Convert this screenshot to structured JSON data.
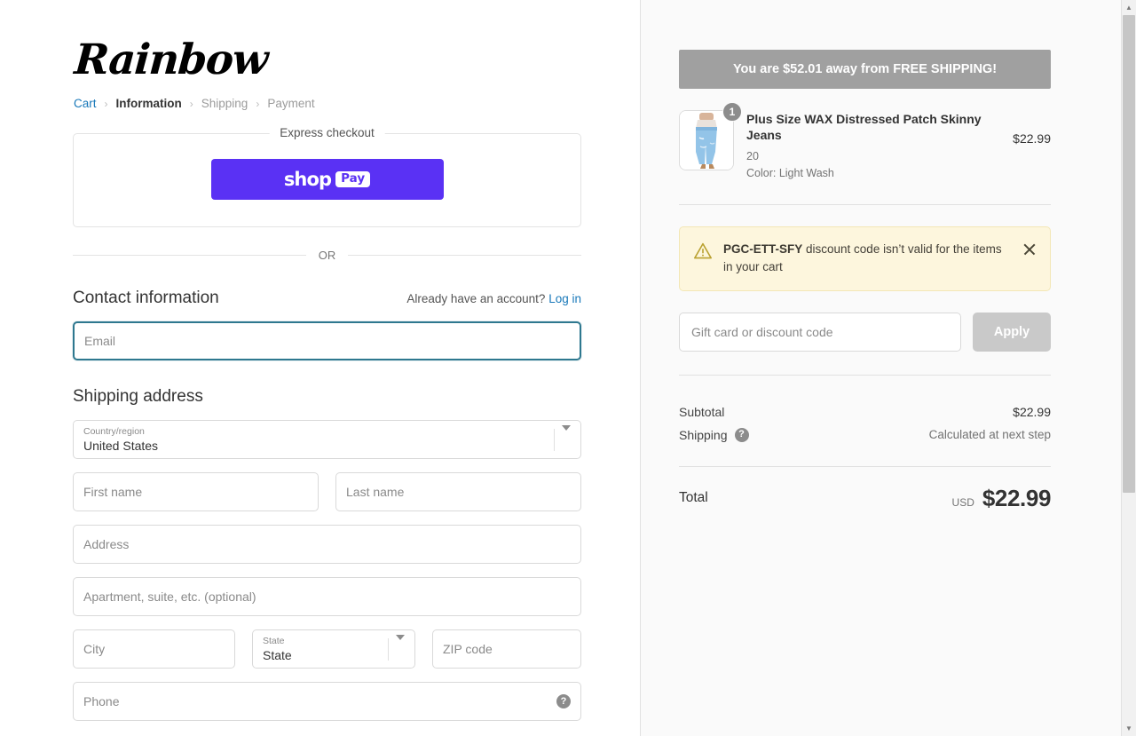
{
  "brand": {
    "logo_text": "Rainbow"
  },
  "breadcrumb": [
    {
      "label": "Cart",
      "state": "link"
    },
    {
      "label": "Information",
      "state": "current"
    },
    {
      "label": "Shipping",
      "state": "future"
    },
    {
      "label": "Payment",
      "state": "future"
    }
  ],
  "breadcrumb_separator": "›",
  "express": {
    "legend": "Express checkout",
    "shop_pay_word": "shop",
    "shop_pay_badge": "Pay"
  },
  "divider_text": "OR",
  "contact": {
    "title": "Contact information",
    "account_prompt": "Already have an account?",
    "login_label": "Log in",
    "email_placeholder": "Email",
    "email_value": ""
  },
  "shipping_address": {
    "title": "Shipping address",
    "country_label": "Country/region",
    "country_value": "United States",
    "first_name_placeholder": "First name",
    "last_name_placeholder": "Last name",
    "address_placeholder": "Address",
    "apartment_placeholder": "Apartment, suite, etc. (optional)",
    "city_placeholder": "City",
    "state_label": "State",
    "state_value": "State",
    "zip_placeholder": "ZIP code",
    "phone_placeholder": "Phone",
    "phone_help_icon": "question-mark"
  },
  "summary": {
    "free_shipping_banner": "You are $52.01 away from FREE SHIPPING!",
    "line_item": {
      "quantity": "1",
      "title": "Plus Size WAX Distressed Patch Skinny Jeans",
      "size": "20",
      "color": "Color: Light Wash",
      "price": "$22.99",
      "image_alt": "light wash skinny jeans"
    },
    "alert": {
      "icon": "warning-triangle-icon",
      "code": "PGC-ETT-SFY",
      "message": " discount code isn’t valid for the items in your cart",
      "close_icon": "close-icon"
    },
    "discount": {
      "placeholder": "Gift card or discount code",
      "value": "",
      "apply_label": "Apply"
    },
    "totals": {
      "subtotal_label": "Subtotal",
      "subtotal_value": "$22.99",
      "shipping_label": "Shipping",
      "shipping_help_icon": "question-mark",
      "shipping_value": "Calculated at next step",
      "total_label": "Total",
      "currency": "USD",
      "total_value": "$22.99"
    }
  },
  "colors": {
    "accent_focus": "#2e788f",
    "link": "#1878b9",
    "shop_pay_purple": "#5a31f4",
    "banner_gray": "#a0a0a0",
    "alert_bg": "#fdf6dd",
    "apply_disabled": "#c9c9c9"
  },
  "scrollbar": {
    "up_arrow": "▲",
    "down_arrow": "▼"
  }
}
